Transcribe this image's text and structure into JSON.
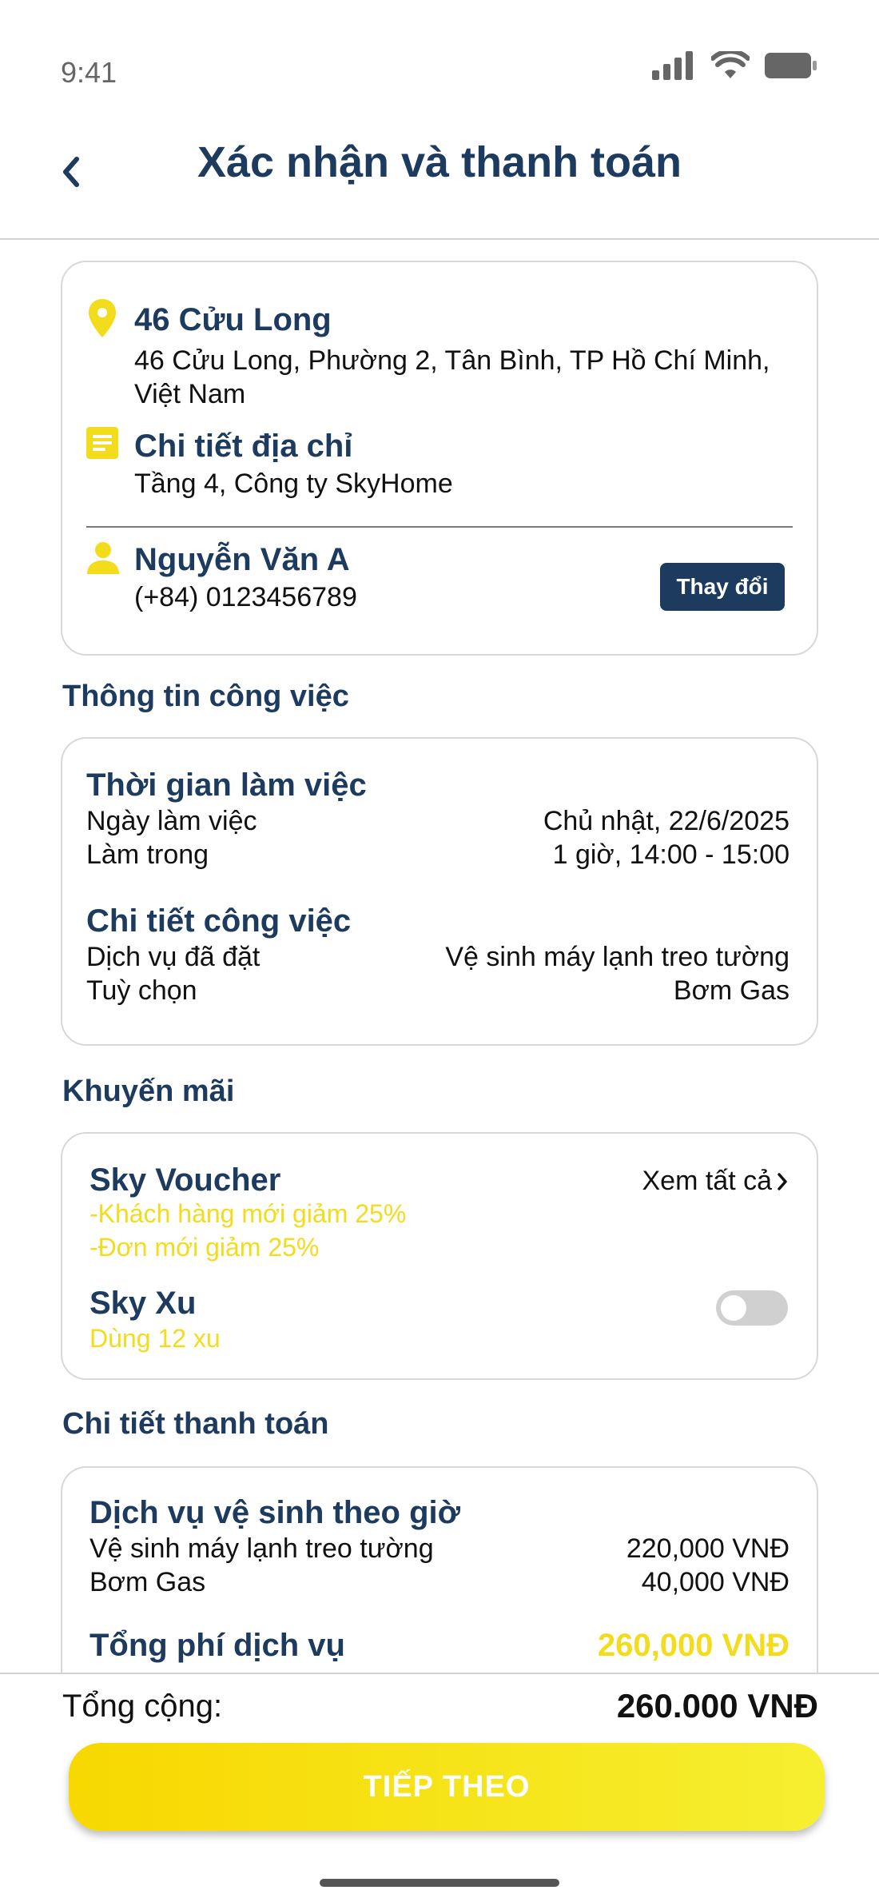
{
  "status_bar": {
    "time": "9:41"
  },
  "header": {
    "title": "Xác nhận và thanh toán"
  },
  "address": {
    "name": "46 Cửu Long",
    "full": "46 Cửu Long, Phường 2, Tân Bình, TP Hồ Chí Minh, Việt Nam",
    "detail_label": "Chi tiết địa chỉ",
    "detail": "Tầng 4, Công ty SkyHome",
    "contact_name": "Nguyễn Văn A",
    "contact_phone": "(+84) 0123456789",
    "change_label": "Thay đổi"
  },
  "job": {
    "section_title": "Thông tin công việc",
    "time_heading": "Thời gian làm việc",
    "work_date_label": "Ngày làm việc",
    "work_date": "Chủ nhật, 22/6/2025",
    "duration_label": "Làm trong",
    "duration": "1 giờ, 14:00 - 15:00",
    "detail_heading": "Chi tiết công việc",
    "service_label": "Dịch vụ đã đặt",
    "service": "Vệ sinh máy lạnh treo tường",
    "option_label": "Tuỳ chọn",
    "option": "Bơm Gas"
  },
  "promo": {
    "section_title": "Khuyến mãi",
    "voucher_heading": "Sky Voucher",
    "see_all": "Xem tất cả",
    "voucher_1": "-Khách hàng mới giảm 25%",
    "voucher_2": "-Đơn mới giảm 25%",
    "xu_heading": "Sky Xu",
    "xu_text": "Dùng 12 xu",
    "xu_toggle_on": false
  },
  "payment": {
    "section_title": "Chi tiết thanh toán",
    "heading": "Dịch vụ vệ sinh theo giờ",
    "items": [
      {
        "label": "Vệ sinh máy lạnh treo tường",
        "amount": "220,000 VNĐ"
      },
      {
        "label": "Bơm Gas",
        "amount": "40,000 VNĐ"
      }
    ],
    "total_label": "Tổng phí dịch vụ",
    "total_amount": "260,000 VNĐ"
  },
  "footer": {
    "total_label": "Tổng cộng:",
    "total_value": "260.000 VNĐ",
    "next_label": "TIẾP THEO"
  },
  "colors": {
    "navy": "#1d3a5f",
    "yellow": "#f2dc1c"
  }
}
